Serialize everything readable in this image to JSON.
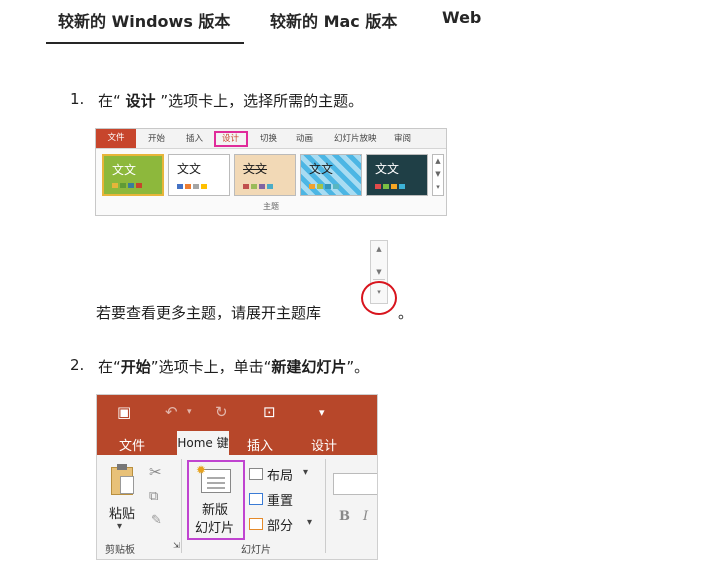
{
  "tabs": {
    "windows": "较新的 Windows 版本",
    "mac": "较新的 Mac 版本",
    "web": "Web"
  },
  "step1": {
    "num": "1.",
    "pre": "在“ ",
    "bold": "设计",
    "post": " ”选项卡上，选择所需的主题。"
  },
  "design_ribbon": {
    "tabs": [
      "文件",
      "开始",
      "插入",
      "设计",
      "切换",
      "动画",
      "幻灯片放映",
      "审阅"
    ],
    "theme_text": "文文",
    "theme_text_styled": "文文",
    "group_label": "主题",
    "colors": {
      "file_tab": "#c7452c",
      "highlight": "#e02b9a"
    }
  },
  "expand_note": {
    "text": "若要查看更多主题，请展开主题库",
    "period": "。",
    "circle_color": "#d8141d"
  },
  "step2": {
    "num": "2.",
    "pre": "在“",
    "bold1": "开始",
    "mid": "”选项卡上，单击“",
    "bold2": "新建幻灯片",
    "post": "”。"
  },
  "home_ribbon": {
    "qat_icons": [
      "save-icon",
      "undo-icon",
      "redo-icon",
      "present-icon",
      "customize-icon"
    ],
    "tabs": {
      "file": "文件",
      "home": "Home 键",
      "insert": "插入",
      "design": "设计"
    },
    "paste": "粘贴",
    "clipboard": "剪贴板",
    "new_slide_line1": "新版",
    "new_slide_line2": "幻灯片",
    "layout": "布局",
    "reset": "重置",
    "section": "部分",
    "slides_group": "幻灯片",
    "bold": "B",
    "italic": "I",
    "colors": {
      "ribbon": "#b7472a",
      "highlight": "#c044d0"
    }
  }
}
